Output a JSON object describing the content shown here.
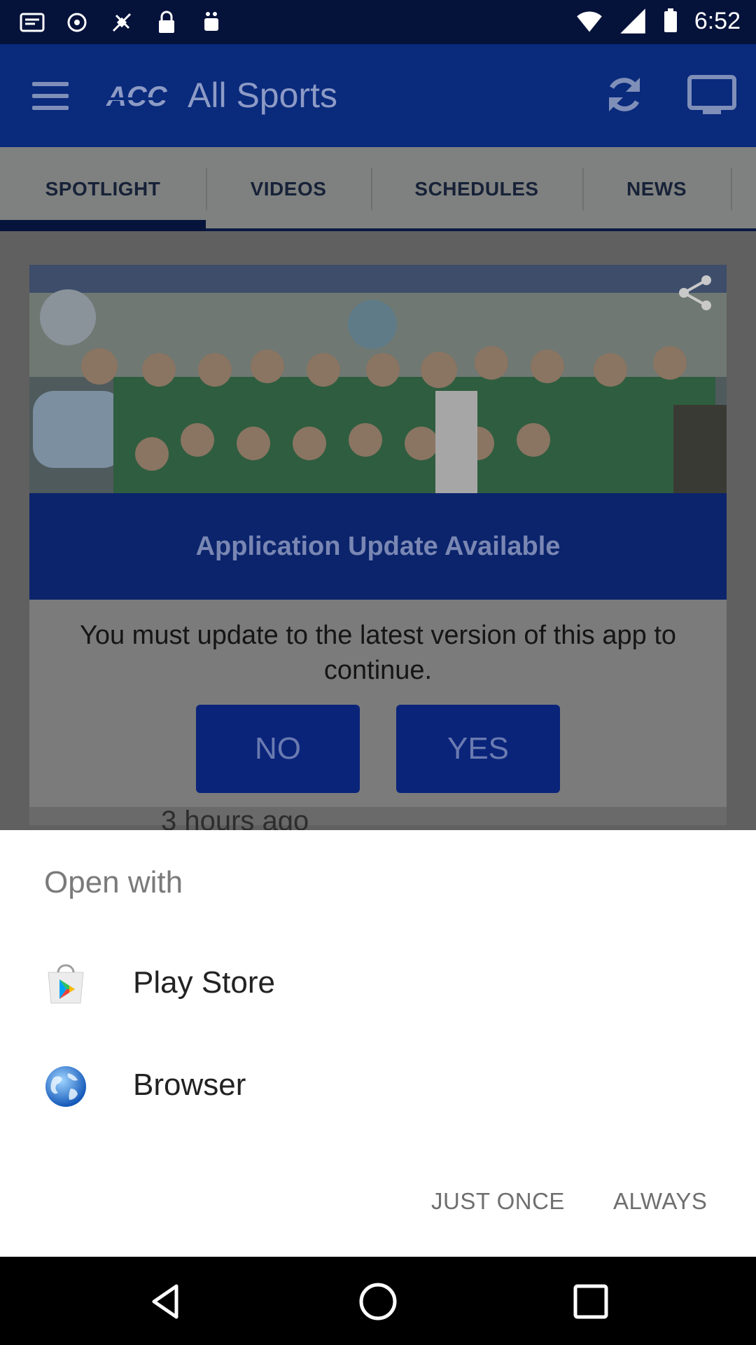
{
  "status_bar": {
    "time": "6:52",
    "left_icons": [
      "notification-icon",
      "sync-icon",
      "satellite-icon",
      "lock-icon",
      "android-icon"
    ],
    "right_icons": [
      "wifi-icon",
      "signal-icon",
      "battery-icon"
    ]
  },
  "app_bar": {
    "logo_text": "ACC",
    "title": "All Sports",
    "icons": [
      "menu-icon",
      "refresh-icon",
      "tv-icon"
    ]
  },
  "tabs": [
    {
      "label": "SPOTLIGHT",
      "selected": true
    },
    {
      "label": "VIDEOS",
      "selected": false
    },
    {
      "label": "SCHEDULES",
      "selected": false
    },
    {
      "label": "NEWS",
      "selected": false
    }
  ],
  "feed": {
    "timestamp": "3 hours ago"
  },
  "update_dialog": {
    "title": "Application Update Available",
    "message": "You must update to the latest version of this app to continue.",
    "no_label": "NO",
    "yes_label": "YES"
  },
  "open_with": {
    "title": "Open with",
    "apps": [
      {
        "label": "Play Store",
        "icon": "play-store-icon"
      },
      {
        "label": "Browser",
        "icon": "browser-globe-icon"
      }
    ],
    "just_once_label": "JUST ONCE",
    "always_label": "ALWAYS"
  },
  "nav_bar": {
    "icons": [
      "back-icon",
      "home-icon",
      "recents-icon"
    ]
  },
  "colors": {
    "app_bar": "#0a2a7c",
    "dialog_header": "#0b246c",
    "dialog_button": "#0a247a",
    "sheet_bg": "#ffffff"
  }
}
